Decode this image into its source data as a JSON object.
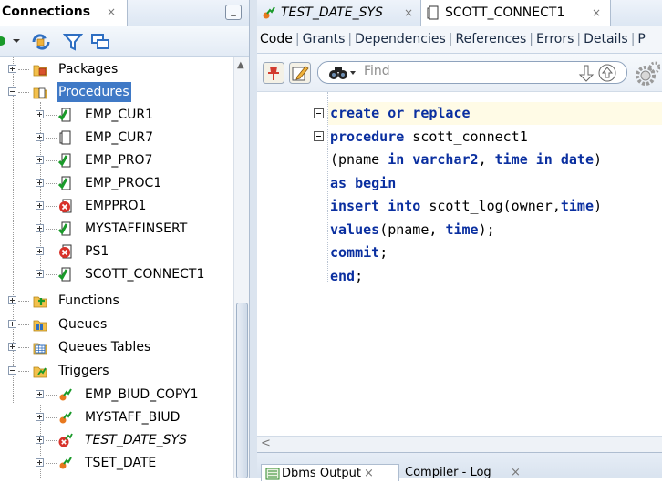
{
  "connections_panel": {
    "tab_label": "Connections",
    "tab_close": "×",
    "minimize_label": "_"
  },
  "tree": {
    "items": [
      {
        "label": "Packages",
        "icon": "package-folder-icon"
      },
      {
        "label": "Procedures",
        "icon": "procedure-folder-icon"
      },
      {
        "label": "EMP_CUR1",
        "icon": "procedure-valid-icon"
      },
      {
        "label": "EMP_CUR7",
        "icon": "procedure-icon"
      },
      {
        "label": "EMP_PRO7",
        "icon": "procedure-valid-icon"
      },
      {
        "label": "EMP_PROC1",
        "icon": "procedure-valid-icon"
      },
      {
        "label": "EMPPRO1",
        "icon": "procedure-error-icon"
      },
      {
        "label": "MYSTAFFINSERT",
        "icon": "procedure-valid-icon"
      },
      {
        "label": "PS1",
        "icon": "procedure-error-icon"
      },
      {
        "label": "SCOTT_CONNECT1",
        "icon": "procedure-valid-icon"
      },
      {
        "label": "Functions",
        "icon": "function-folder-icon"
      },
      {
        "label": "Queues",
        "icon": "queue-folder-icon"
      },
      {
        "label": "Queues Tables",
        "icon": "queue-table-folder-icon"
      },
      {
        "label": "Triggers",
        "icon": "trigger-folder-icon"
      },
      {
        "label": "EMP_BIUD_COPY1",
        "icon": "trigger-icon"
      },
      {
        "label": "MYSTAFF_BIUD",
        "icon": "trigger-icon"
      },
      {
        "label": "TEST_DATE_SYS",
        "icon": "trigger-error-icon"
      },
      {
        "label": "TSET_DATE",
        "icon": "trigger-icon"
      }
    ]
  },
  "doc_tabs": [
    {
      "label": "TEST_DATE_SYS",
      "close": "×",
      "icon": "trigger-icon"
    },
    {
      "label": "SCOTT_CONNECT1",
      "close": "×",
      "icon": "procedure-icon"
    }
  ],
  "sub_tabs": [
    "Code",
    "Grants",
    "Dependencies",
    "References",
    "Errors",
    "Details",
    "P"
  ],
  "find": {
    "placeholder": "Find"
  },
  "code": {
    "lines": [
      {
        "parts": [
          {
            "t": "create or replace",
            "k": true
          }
        ]
      },
      {
        "parts": [
          {
            "t": "procedure",
            "k": true
          },
          {
            "t": " scott_connect1",
            "k": false
          }
        ]
      },
      {
        "parts": [
          {
            "t": "(pname ",
            "k": false
          },
          {
            "t": "in varchar2",
            "k": true
          },
          {
            "t": ", ",
            "k": false
          },
          {
            "t": "time in date",
            "k": true
          },
          {
            "t": ")",
            "k": false
          }
        ]
      },
      {
        "parts": [
          {
            "t": "as begin",
            "k": true
          }
        ]
      },
      {
        "parts": [
          {
            "t": "insert into",
            "k": true
          },
          {
            "t": " scott_log(owner,",
            "k": false
          },
          {
            "t": "time",
            "k": true
          },
          {
            "t": ")",
            "k": false
          }
        ]
      },
      {
        "parts": [
          {
            "t": "values",
            "k": true
          },
          {
            "t": "(pname, ",
            "k": false
          },
          {
            "t": "time",
            "k": true
          },
          {
            "t": ");",
            "k": false
          }
        ]
      },
      {
        "parts": [
          {
            "t": "commit",
            "k": true
          },
          {
            "t": ";",
            "k": false
          }
        ]
      },
      {
        "parts": [
          {
            "t": "end",
            "k": true
          },
          {
            "t": ";",
            "k": false
          }
        ]
      }
    ]
  },
  "scroll_left_arrow": "<",
  "bottom_tabs": [
    {
      "label": "Dbms Output",
      "close": "×"
    },
    {
      "label": "Compiler - Log",
      "close": "×"
    }
  ],
  "colors": {
    "selection": "#3f79c6",
    "keyword": "#0a2fa0",
    "current_line": "#fffbe6"
  }
}
